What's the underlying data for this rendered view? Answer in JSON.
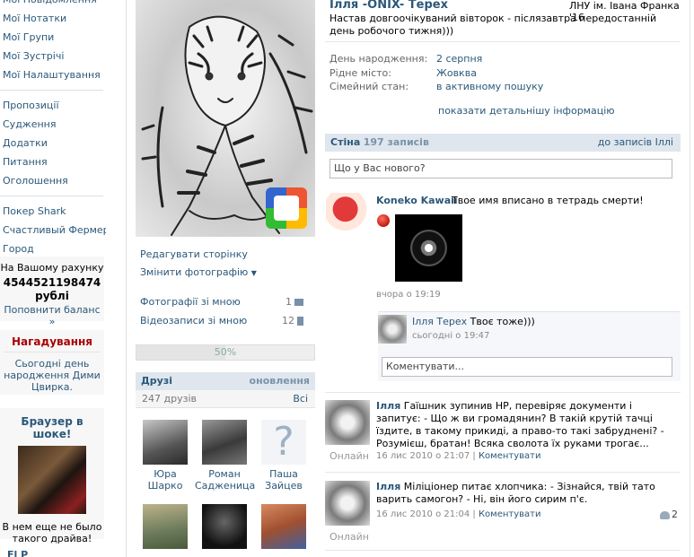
{
  "sidebar": {
    "items_top": [
      "Мої Повідомлення",
      "Мої Нотатки",
      "Мої Групи",
      "Мої Зустрічі",
      "Мої Налаштування"
    ],
    "items_mid": [
      "Пропозиції",
      "Судження",
      "Додатки",
      "Питання",
      "Оголошення"
    ],
    "items_apps": [
      "Покер Shark",
      "Счастливый Фермер",
      "Город"
    ],
    "balance": {
      "title": "На Вашому рахунку",
      "amount": "4544521198474",
      "currency": "рублі",
      "topup": "Поповнити баланс »"
    },
    "reminder": {
      "title": "Нагадування",
      "text_prefix": "Сьогодні день народження",
      "name": "Дими Цвирка",
      "suffix": "."
    },
    "ad": {
      "title": "Браузер в шоке!",
      "text": "В нем еще не было такого драйва!"
    },
    "bottom_cut": "Fl  P"
  },
  "profile": {
    "edit_page": "Редагувати сторінку",
    "change_photo": "Змінити фотографію",
    "photos_with_me": "Фотографії зі мною",
    "photos_count": "1",
    "videos_with_me": "Відеозаписи зі мною",
    "videos_count": "12",
    "progress_label": "50%",
    "progress_value": 50,
    "friends_title": "Друзі",
    "friends_updates": "оновлення",
    "friends_count": "247 друзів",
    "friends_all": "Всі",
    "friends": [
      {
        "first": "Юра",
        "last": "Шарко"
      },
      {
        "first": "Роман",
        "last": "Садженица"
      },
      {
        "first": "Паша",
        "last": "Зайцев"
      }
    ]
  },
  "header": {
    "name": "Ілля -ONIX- Терех",
    "school": "ЛНУ ім. Івана Франка '16",
    "status": "Настав довгоочікуваний вівторок - післязавтра передостанній день робочого тижня)))"
  },
  "info": {
    "birthday_label": "День народження:",
    "birthday": "2 серпня",
    "hometown_label": "Рідне місто:",
    "hometown": "Жовква",
    "family_label": "Сімейний стан:",
    "family": "в активному пошуку",
    "more": "показати детальнішу інформацію"
  },
  "wall": {
    "title": "Стіна",
    "count": "197 записів",
    "to_posts": "до записів Іллі",
    "input_placeholder": "Що у Вас нового?",
    "posts": [
      {
        "author": "Koneko Kawaii",
        "text": "Твое имя вписано в тетрадь смерти!",
        "time": "вчора о 19:19"
      },
      {
        "author": "Ілля",
        "text": "Гаїшник зупинив НР, перевіряє документи і запитує: - Що ж ви громадянин? В такій крутій тачці їздите, в такому прикиді, а право-то такі забруднені? - Розумієш, братан! Всяка сволота їх руками трогає...",
        "time": "16 лис 2010 о 21:07",
        "comments": "Коментувати",
        "online": "Онлайн"
      },
      {
        "author": "Ілля",
        "text": "Міліціонер питає хлопчика: - Зізнайся, твій тато варить самогон? - Ні, він його сирим п'є.",
        "time": "16 лис 2010 о 21:04",
        "comments": "Коментувати",
        "online": "Онлайн",
        "likes": "2"
      }
    ],
    "reply": {
      "author": "Ілля Терех",
      "text": "Твоє тоже)))",
      "time": "сьогодні о 19:47"
    },
    "comment_placeholder": "Коментувати..."
  },
  "colors": {
    "link": "#2b587a",
    "header_bg": "#dfe6ee",
    "reminder": "#aa0000"
  }
}
